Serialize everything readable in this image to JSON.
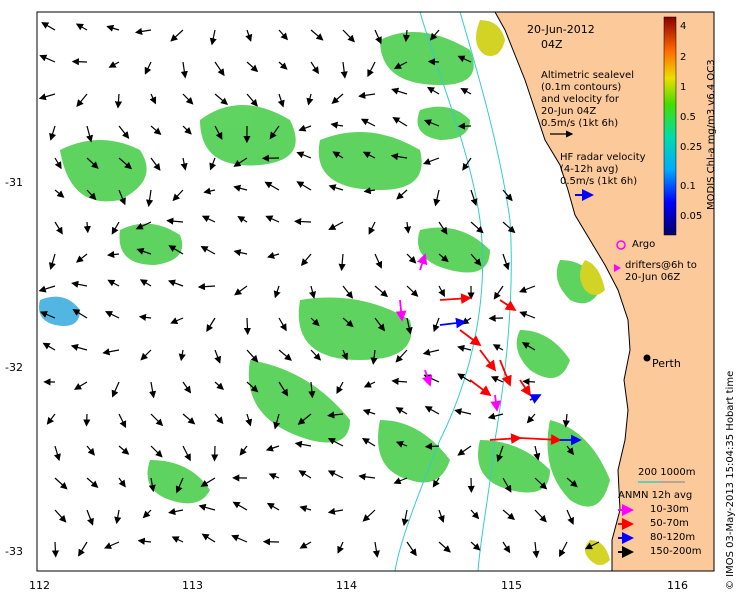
{
  "map": {
    "date_line1": "20-Jun-2012",
    "date_line2": "04Z",
    "altimetric_lines": [
      "Altimetric sealevel",
      "(0.1m contours)",
      "and velocity for",
      "20-Jun 04Z",
      "0.5m/s (1kt 6h)"
    ],
    "hf_lines": [
      "HF radar velocity",
      "(4-12h avg)",
      "0.5m/s (1kt 6h)"
    ],
    "argo_label": "Argo",
    "drifter_lines": [
      "drifters@6h to",
      "20-Jun 06Z"
    ],
    "city_label": "Perth",
    "scale_label": "200  1000m",
    "anmn_title": "ANMN 12h avg",
    "anmn_items": [
      {
        "label": "10-30m",
        "color": "#ff00ff"
      },
      {
        "label": "50-70m",
        "color": "#ff0000"
      },
      {
        "label": "80-120m",
        "color": "#0000ff"
      },
      {
        "label": "150-200m",
        "color": "#000000"
      }
    ],
    "colorbar_title": "MODIS Chl-a mg/m3 v6.4 OC3",
    "colorbar_ticks": [
      "4",
      "2",
      "1",
      "0.5",
      "0.25",
      "0.1",
      "0.05"
    ],
    "credit": "© IMOS 03-May-2013 15:04:35 Hobart time",
    "x_ticks": [
      "112",
      "113",
      "114",
      "115",
      "116"
    ],
    "y_ticks": [
      "-31",
      "-32",
      "-33"
    ],
    "colors": {
      "land": "#fcc99b",
      "ocean": "#ffffff",
      "chl_green": "#33cc33",
      "contour": "#33cccc"
    }
  }
}
